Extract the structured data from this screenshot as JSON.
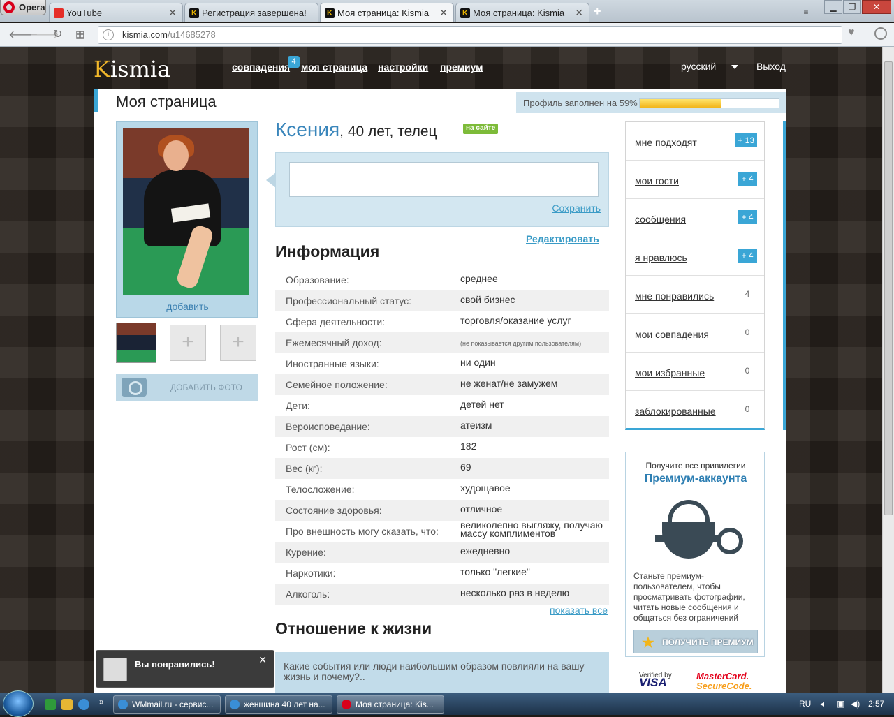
{
  "browser": {
    "menu_label": "Opera",
    "tabs": [
      {
        "title": "YouTube",
        "icon": "youtube-icon"
      },
      {
        "title": "Регистрация завершена!",
        "icon": "kismia-icon"
      },
      {
        "title": "Моя страница: Kismia",
        "icon": "kismia-icon",
        "active": true
      },
      {
        "title": "Моя страница: Kismia",
        "icon": "kismia-icon"
      }
    ],
    "url_host": "kismia.com",
    "url_path": "/u14685278"
  },
  "site": {
    "logo_first": "K",
    "logo_rest": "ismia",
    "nav": [
      "совпадения",
      "моя страница",
      "настройки",
      "премиум"
    ],
    "matches_badge": "4",
    "language": "русский",
    "logout": "Выход"
  },
  "page": {
    "title": "Моя страница",
    "profile_fill_label": "Профиль заполнен на 59%",
    "profile_fill_fraction": 0.59
  },
  "photos": {
    "add_link": "добавить",
    "add_photo_button": "ДОБАВИТЬ ФОТО"
  },
  "profile": {
    "name": "Ксения",
    "details": ", 40 лет, телец",
    "online_badge": "на сайте",
    "save_link": "Сохранить",
    "edit_link": "Редактировать",
    "info_heading": "Информация",
    "info": [
      {
        "k": "Образование:",
        "v": "среднее"
      },
      {
        "k": "Профессиональный статус:",
        "v": "свой бизнес"
      },
      {
        "k": "Сфера деятельности:",
        "v": "торговля/оказание услуг"
      },
      {
        "k": "Ежемесячный доход:",
        "v": "(не показывается другим пользователям)",
        "small": true
      },
      {
        "k": "Иностранные языки:",
        "v": "ни один"
      },
      {
        "k": "Семейное положение:",
        "v": "не женат/не замужем"
      },
      {
        "k": "Дети:",
        "v": "детей нет"
      },
      {
        "k": "Вероисповедание:",
        "v": "атеизм"
      },
      {
        "k": "Рост (см):",
        "v": "182"
      },
      {
        "k": "Вес (кг):",
        "v": "69"
      },
      {
        "k": "Телосложение:",
        "v": "худощавое"
      },
      {
        "k": "Состояние здоровья:",
        "v": "отличное"
      },
      {
        "k": "Про внешность могу сказать, что:",
        "v": "великолепно выгляжу, получаю массу комплиментов"
      },
      {
        "k": "Курение:",
        "v": "ежедневно"
      },
      {
        "k": "Наркотики:",
        "v": "только \"легкие\""
      },
      {
        "k": "Алкоголь:",
        "v": "несколько раз в неделю"
      }
    ],
    "show_all": "показать все",
    "life_heading": "Отношение к жизни",
    "life_question": "Какие события или люди наибольшим образом повлияли на вашу жизнь и почему?.."
  },
  "sidebar": {
    "items": [
      {
        "label": "мне подходят",
        "count": "+ 13",
        "highlight": true
      },
      {
        "label": "мои гости",
        "count": "+ 4",
        "highlight": true
      },
      {
        "label": "сообщения",
        "count": "+ 4",
        "highlight": true
      },
      {
        "label": "я нравлюсь",
        "count": "+ 4",
        "highlight": true
      },
      {
        "label": "мне понравились",
        "count": "4",
        "highlight": false
      },
      {
        "label": "мои совпадения",
        "count": "0",
        "highlight": false
      },
      {
        "label": "мои избранные",
        "count": "0",
        "highlight": false
      },
      {
        "label": "заблокированные",
        "count": "0",
        "highlight": false
      }
    ]
  },
  "premium": {
    "line1": "Получите все привилегии",
    "line2": "Премиум-аккаунта",
    "description": "Станьте премиум-пользователем, чтобы просматривать фотографии, читать новые сообщения и общаться без ограничений",
    "button": "ПОЛУЧИТЬ ПРЕМИУМ",
    "visa_small": "Verified by",
    "visa_big": "VISA",
    "mc_line1": "MasterCard.",
    "mc_line2": "SecureCode."
  },
  "toast": {
    "text": "Вы понравились!"
  },
  "taskbar": {
    "tasks": [
      "WMmail.ru - сервис...",
      "женщина 40 лет на...",
      "Моя страница: Kis..."
    ],
    "lang": "RU",
    "time": "2:57"
  }
}
